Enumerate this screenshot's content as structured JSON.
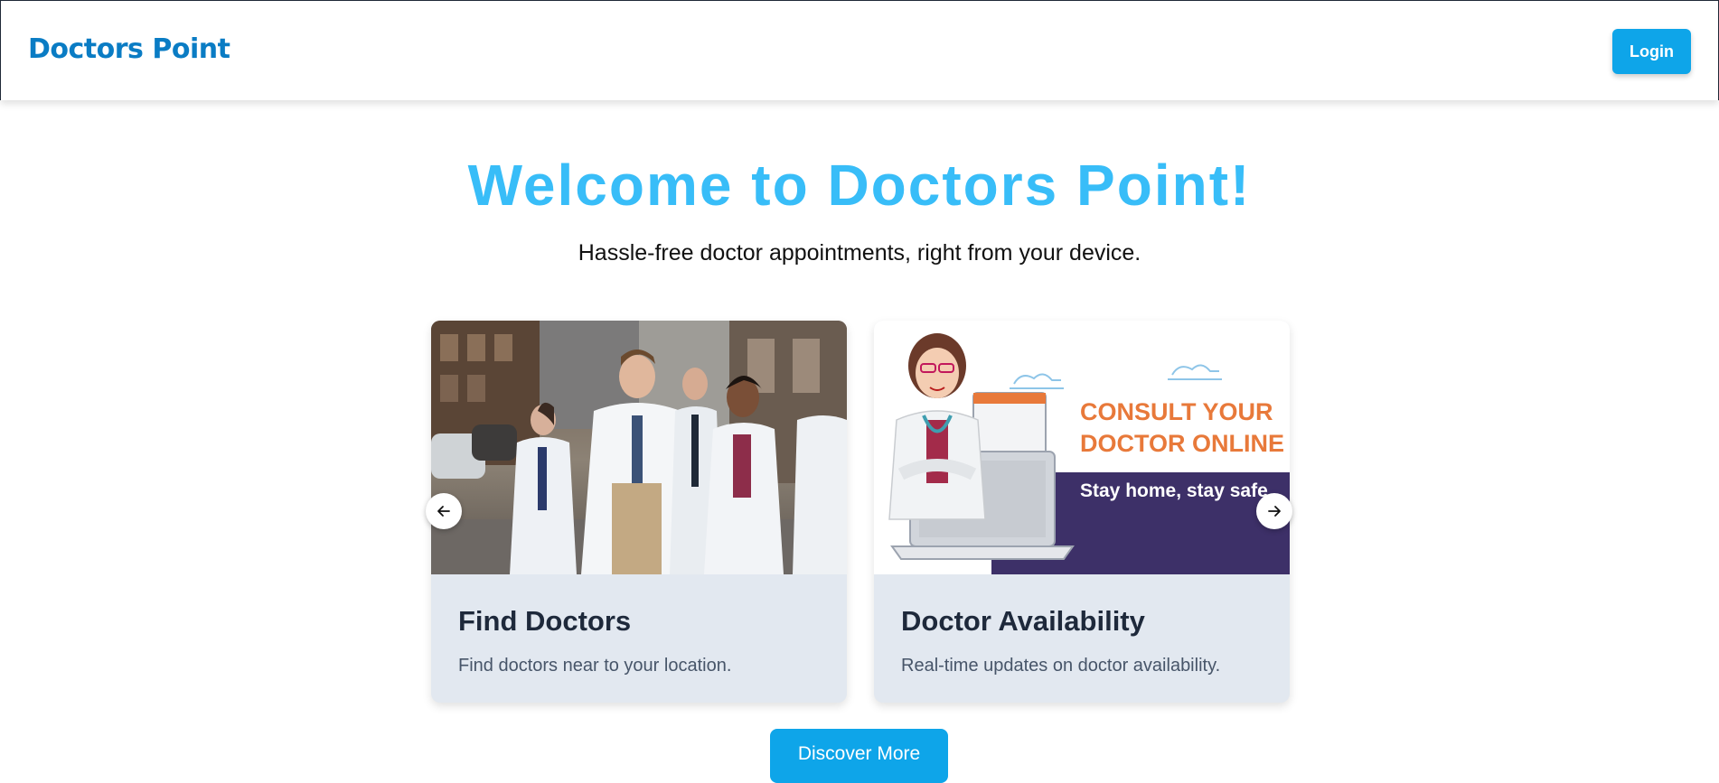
{
  "navbar": {
    "brand": "Doctors Point",
    "login_label": "Login"
  },
  "hero": {
    "title": "Welcome to Doctors Point!",
    "subtitle": "Hassle-free doctor appointments, right from your device."
  },
  "carousel": {
    "cards": [
      {
        "title": "Find Doctors",
        "description": "Find doctors near to your location."
      },
      {
        "title": "Doctor Availability",
        "description": "Real-time updates on doctor availability.",
        "image_text": {
          "line1": "CONSULT YOUR",
          "line2": "DOCTOR ONLINE",
          "line3": "Stay home, stay safe"
        }
      }
    ],
    "prev_icon": "arrow-left-icon",
    "next_icon": "arrow-right-icon"
  },
  "cta": {
    "discover_label": "Discover More"
  },
  "colors": {
    "brand": "#0a7cc4",
    "accent": "#0ea5e9",
    "title": "#38bdf8",
    "card_bg": "#e2e8f0",
    "consult_purple": "#3d3068",
    "consult_orange": "#e8793a"
  }
}
